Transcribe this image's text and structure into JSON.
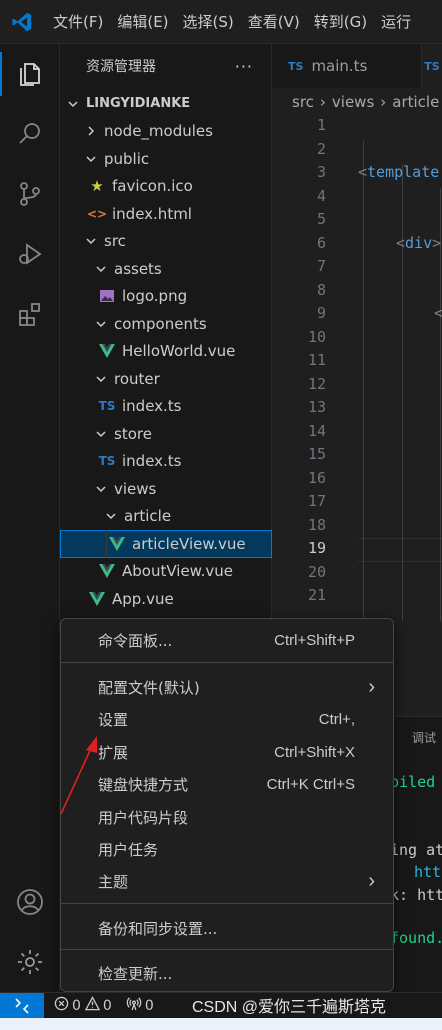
{
  "menubar": {
    "items": [
      "文件(F)",
      "编辑(E)",
      "选择(S)",
      "查看(V)",
      "转到(G)",
      "运行"
    ]
  },
  "explorer": {
    "title": "资源管理器",
    "more": "···",
    "root": "LINGYIDIANKE",
    "items": [
      {
        "label": "node_modules"
      },
      {
        "label": "public"
      },
      {
        "label": "favicon.ico",
        "icon": "star-icon"
      },
      {
        "label": "index.html",
        "icon": "html-icon"
      },
      {
        "label": "src"
      },
      {
        "label": "assets"
      },
      {
        "label": "logo.png",
        "icon": "image-icon"
      },
      {
        "label": "components"
      },
      {
        "label": "HelloWorld.vue",
        "icon": "vue-icon"
      },
      {
        "label": "router"
      },
      {
        "label": "index.ts",
        "icon": "ts-icon"
      },
      {
        "label": "store"
      },
      {
        "label": "index.ts",
        "icon": "ts-icon"
      },
      {
        "label": "views"
      },
      {
        "label": "article"
      },
      {
        "label": "articleView.vue",
        "icon": "vue-icon"
      },
      {
        "label": "AboutView.vue",
        "icon": "vue-icon"
      },
      {
        "label": "App.vue",
        "icon": "vue-icon"
      }
    ]
  },
  "editor": {
    "tab_label": "main.ts",
    "tab_badge": "TS",
    "breadcrumb": [
      "src",
      "views",
      "article"
    ],
    "line_numbers": [
      "1",
      "2",
      "3",
      "4",
      "5",
      "6",
      "7",
      "8",
      "9",
      "10",
      "11",
      "12",
      "13",
      "14",
      "15",
      "16",
      "17",
      "18",
      "19",
      "20",
      "21"
    ],
    "current_line": "19",
    "code_line1_open": "<",
    "code_line1_tag": "template",
    "code_line2_open": "<",
    "code_line2_tag": "div",
    "code_line2_close": ">",
    "code_line3": "<"
  },
  "panel": {
    "tab": "调试",
    "lines": [
      "piled",
      "ing at",
      "htt",
      "k: htt",
      "found."
    ]
  },
  "context_menu": {
    "items": [
      {
        "label": "命令面板...",
        "shortcut": "Ctrl+Shift+P"
      },
      {
        "label": "配置文件(默认)",
        "submenu": true
      },
      {
        "label": "设置",
        "shortcut": "Ctrl+,"
      },
      {
        "label": "扩展",
        "shortcut": "Ctrl+Shift+X"
      },
      {
        "label": "键盘快捷方式",
        "shortcut": "Ctrl+K Ctrl+S"
      },
      {
        "label": "用户代码片段"
      },
      {
        "label": "用户任务"
      },
      {
        "label": "主题",
        "submenu": true
      },
      {
        "label": "备份和同步设置..."
      },
      {
        "label": "检查更新..."
      }
    ],
    "submenu_glyph": "›"
  },
  "statusbar": {
    "errors": "0",
    "warnings": "0",
    "ports": "0"
  },
  "watermark": "CSDN @爱你三千遍斯塔克",
  "colors": {
    "accent": "#0078d4",
    "vue": "#41b883",
    "ts": "#3178c6",
    "html": "#e37933",
    "star": "#cbcb41",
    "annotation": "#e02020"
  }
}
